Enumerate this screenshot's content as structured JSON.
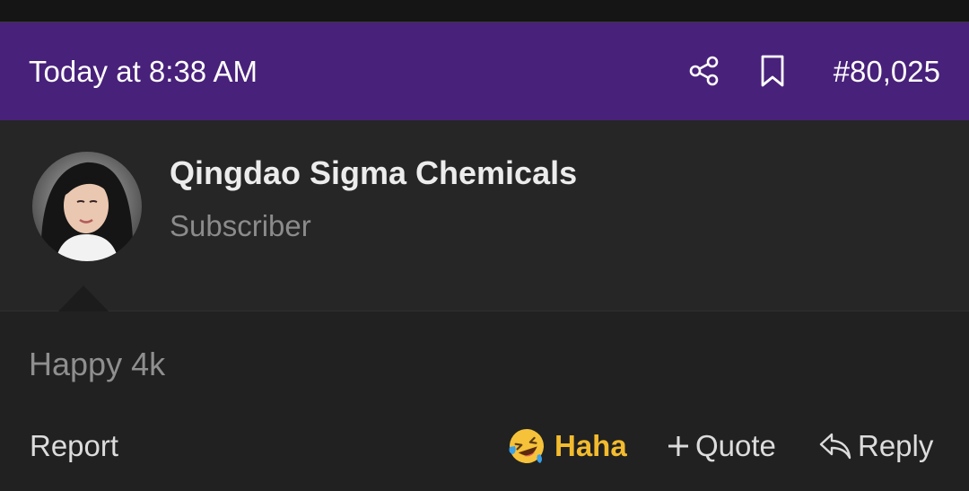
{
  "header": {
    "date": "Today at 8:38 AM",
    "post_number": "#80,025",
    "icons": [
      "share-icon",
      "bookmark-icon"
    ]
  },
  "user": {
    "name": "Qingdao Sigma Chemicals",
    "title": "Subscriber"
  },
  "message": {
    "text": "Happy 4k"
  },
  "footer": {
    "report_label": "Report",
    "reaction_label": "Haha",
    "reaction_icon": "laughing-emoji-icon",
    "quote_label": "Quote",
    "reply_label": "Reply"
  },
  "colors": {
    "header_bg": "#48217a",
    "reaction_color": "#f3bb2e",
    "page_bg": "#232323"
  }
}
